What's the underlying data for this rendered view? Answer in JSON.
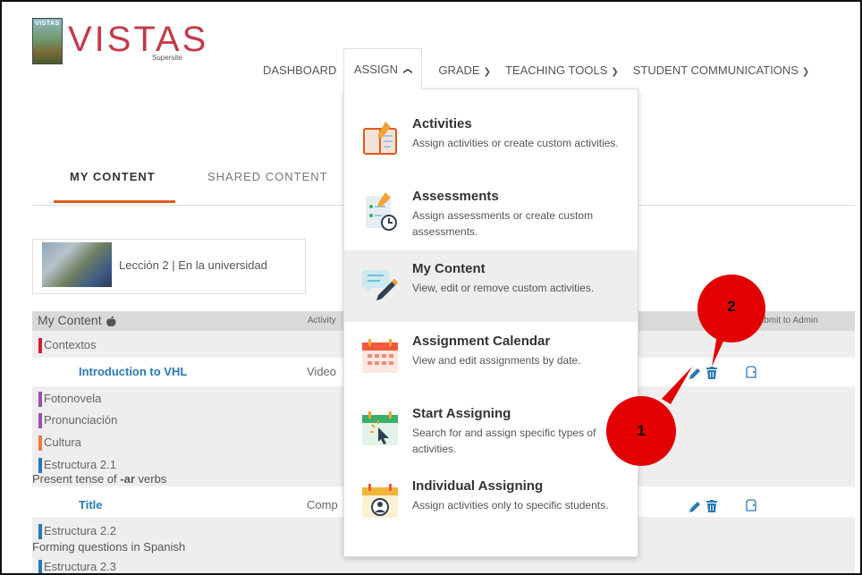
{
  "logo": {
    "title": "VISTAS",
    "book_label": "VISTAS",
    "publisher": "Supersite"
  },
  "nav": {
    "dashboard": "DASHBOARD",
    "assign": "ASSIGN",
    "grade": "GRADE",
    "teaching_tools": "TEACHING TOOLS",
    "student_communications": "STUDENT COMMUNICATIONS"
  },
  "tabs": {
    "my_content": "MY CONTENT",
    "shared_content": "SHARED CONTENT"
  },
  "lesson": {
    "label": "Lección 2 | En la universidad"
  },
  "table": {
    "header_title": "My Content",
    "header_activity": "Activity",
    "header_submit": "Submit to Admin",
    "rows": [
      {
        "tag": "Contextos",
        "color": "#d21f2b"
      },
      {
        "title": "Introduction to VHL",
        "type": "Video"
      },
      {
        "tag": "Fotonovela",
        "color": "#9b4fb0"
      },
      {
        "tag": "Pronunciación",
        "color": "#9b4fb0"
      },
      {
        "tag": "Cultura",
        "color": "#ef7a3b"
      },
      {
        "tag": "Estructura 2.1",
        "color": "#2a79b5"
      },
      {
        "sub_prefix": "Present tense of ",
        "sub_bold": "-ar",
        "sub_suffix": " verbs"
      },
      {
        "title": "Title",
        "type": "Comp"
      },
      {
        "tag": "Estructura 2.2",
        "color": "#2a79b5"
      },
      {
        "subtext": "Forming questions in Spanish"
      },
      {
        "tag": "Estructura 2.3",
        "color": "#2a79b5"
      }
    ]
  },
  "menu": {
    "items": [
      {
        "title": "Activities",
        "desc": "Assign activities or create custom activities."
      },
      {
        "title": "Assessments",
        "desc": "Assign assessments or create custom assessments."
      },
      {
        "title": "My Content",
        "desc": "View, edit or remove custom activities."
      },
      {
        "title": "Assignment Calendar",
        "desc": "View and edit assignments by date."
      },
      {
        "title": "Start Assigning",
        "desc": "Search for and assign specific types of activities."
      },
      {
        "title": "Individual Assigning",
        "desc": "Assign activities only to specific students."
      }
    ]
  },
  "callouts": {
    "one": "1",
    "two": "2"
  },
  "colors": {
    "accent": "#e05a1c",
    "link": "#2a79b5",
    "callout": "#e20000",
    "brand": "#c33b4a"
  }
}
